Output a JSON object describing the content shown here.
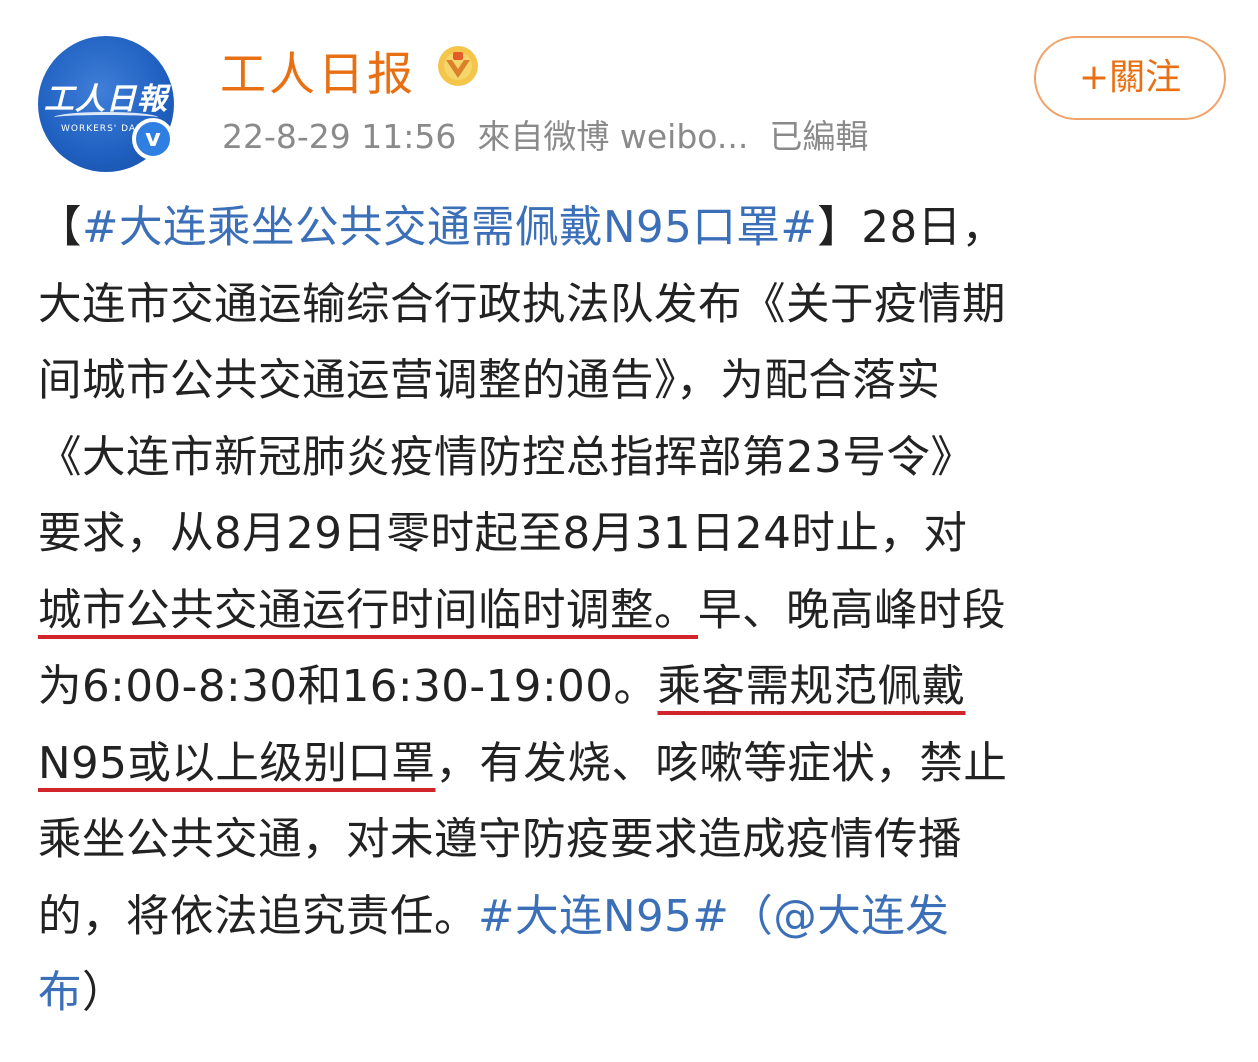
{
  "header": {
    "avatar_logo_cn": "工人日報",
    "avatar_logo_en": "WORKERS' DAILY",
    "author_name": "工人日报",
    "timestamp": "22-8-29 11:56",
    "source": "來自微博 weibo...",
    "edited": "已編輯",
    "follow_label": "+關注",
    "medal_icon": "medal-icon",
    "verified_icon": "verified-v-icon"
  },
  "post": {
    "l1_open": "【",
    "l1_topic": "#大连乘坐公共交通需佩戴N95口罩#",
    "l1_close": "】",
    "l1_rest": "28日，",
    "l2": "大连市交通运输综合行政执法队发布《关于疫情期",
    "l3": "间城市公共交通运营调整的通告》，为配合落实",
    "l4": "《大连市新冠肺炎疫情防控总指挥部第23号令》",
    "l5": "要求，从8月29日零时起至8月31日24时止，对",
    "l6_ul": "城市公共交通运行时间临时调整。",
    "l6_rest": "早、晚高峰时段",
    "l7_a": "为6:00-8:30和16:30-19:00。",
    "l7_ul": "乘客需规范佩戴",
    "l8_ul": "N95或以上级别口罩",
    "l8_rest": "，有发烧、咳嗽等症状，禁止",
    "l9": "乘坐公共交通，对未遵守防疫要求造成疫情传播",
    "l10_a": "的，将依法追究责任。",
    "l10_topic": "#大连N95#",
    "l10_paren": "（",
    "l10_mention": "@大连发",
    "l11_mention": "布",
    "l11_paren": "）"
  },
  "colors": {
    "author": "#e86f12",
    "topic_link": "#3b6fb8",
    "underline": "#d2242b",
    "meta_text": "#8a8a8a"
  }
}
